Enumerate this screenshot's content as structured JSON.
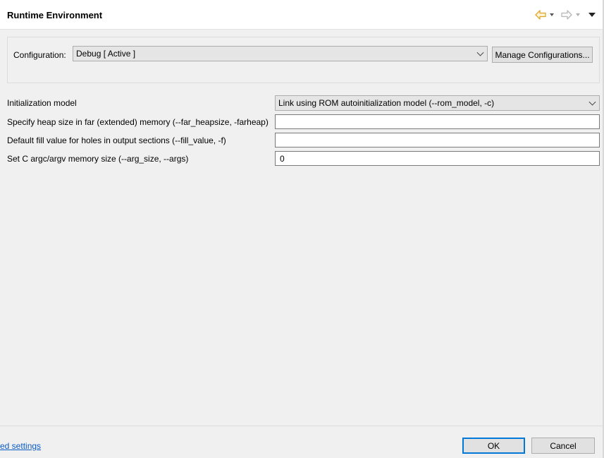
{
  "header": {
    "title": "Runtime Environment",
    "back_icon": "arrow-left-icon",
    "forward_icon": "arrow-right-icon",
    "menu_icon": "view-menu-icon",
    "accent_back": "#e8b23a",
    "disabled_color": "#b0b0b0"
  },
  "configuration": {
    "label": "Configuration:",
    "value": "Debug  [ Active ]",
    "manage_label": "Manage Configurations..."
  },
  "options": [
    {
      "label": "Initialization model",
      "value": "Link using ROM autoinitialization model (--rom_model, -c)",
      "kind": "select"
    },
    {
      "label": "Specify heap size in far (extended) memory (--far_heapsize, -farheap)",
      "value": "",
      "kind": "text"
    },
    {
      "label": "Default fill value for holes in output sections (--fill_value, -f)",
      "value": "",
      "kind": "text"
    },
    {
      "label": "Set C argc/argv memory size (--arg_size, --args)",
      "value": "0",
      "kind": "text"
    }
  ],
  "footer": {
    "link_text": "ed settings",
    "ok_label": "OK",
    "cancel_label": "Cancel"
  }
}
